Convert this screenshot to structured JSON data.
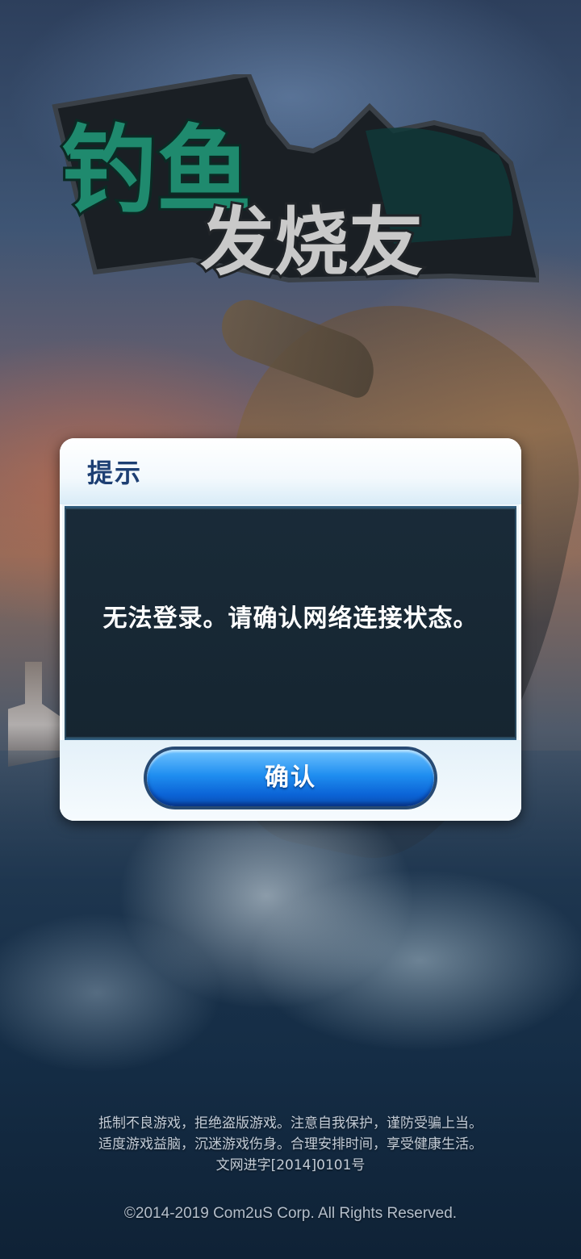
{
  "game": {
    "logo_line1": "钓鱼",
    "logo_line2": "发烧友"
  },
  "dialog": {
    "title": "提示",
    "message": "无法登录。请确认网络连接状态。",
    "confirm_label": "确认"
  },
  "footer": {
    "notice_line1": "抵制不良游戏，拒绝盗版游戏。注意自我保护，谨防受骗上当。",
    "notice_line2": "适度游戏益脑，沉迷游戏伤身。合理安排时间，享受健康生活。",
    "license": "文网进字[2014]0101号",
    "copyright": "©2014-2019 Com2uS Corp. All Rights Reserved."
  },
  "colors": {
    "dialog_title": "#1d3f73",
    "button_blue": "#1f8ef0",
    "logo_teal": "#1f8a6e"
  }
}
